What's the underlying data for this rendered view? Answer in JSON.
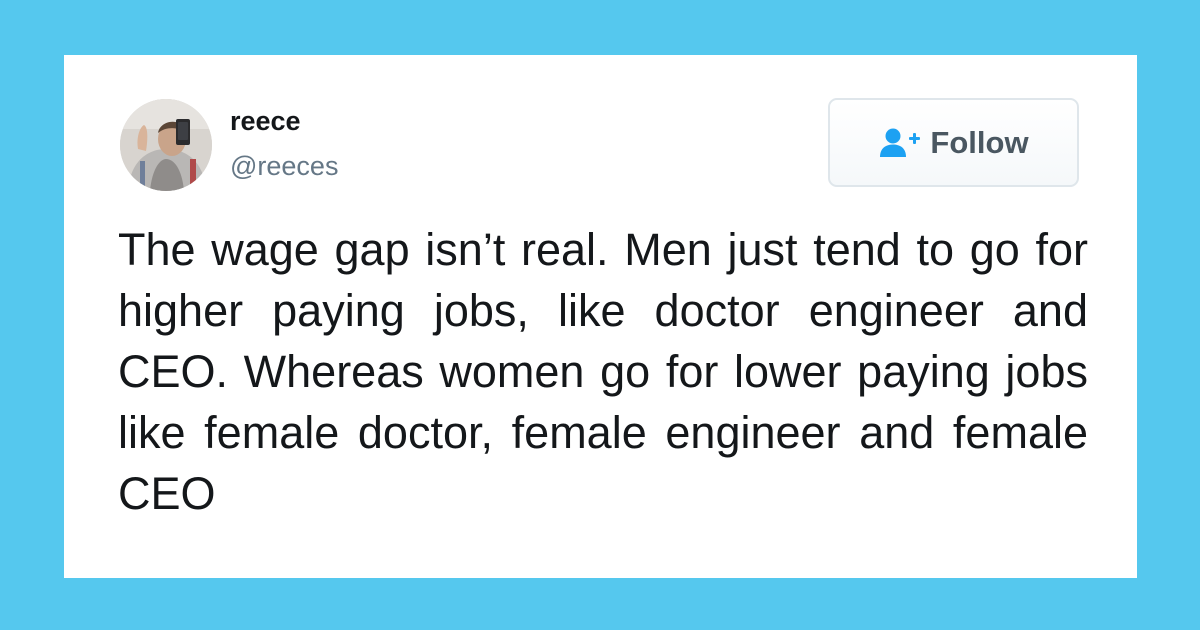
{
  "tweet": {
    "author": {
      "name": "reece",
      "handle": "@reeces"
    },
    "follow_button": {
      "label": "Follow",
      "icon": "follow-user-plus-icon"
    },
    "text": "The wage gap isn’t real. Men just tend to go for higher paying jobs, like doctor engineer and CEO. Whereas women go for lower paying jobs like female doctor, female engineer and female CEO"
  },
  "colors": {
    "background": "#55c8ee",
    "card": "#ffffff",
    "name": "#14171a",
    "handle": "#657786",
    "follow_text": "#4a5761",
    "follow_icon": "#1da1f2"
  }
}
